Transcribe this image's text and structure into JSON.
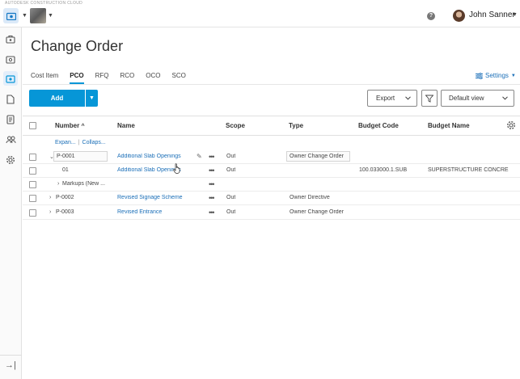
{
  "brand": "AUTODESK CONSTRUCTION CLOUD",
  "header": {
    "user_name": "John Sanner",
    "help": "?"
  },
  "page": {
    "title": "Change Order"
  },
  "tabs": [
    {
      "label": "Cost Item",
      "active": false
    },
    {
      "label": "PCO",
      "active": true
    },
    {
      "label": "RFQ",
      "active": false
    },
    {
      "label": "RCO",
      "active": false
    },
    {
      "label": "OCO",
      "active": false
    },
    {
      "label": "SCO",
      "active": false
    }
  ],
  "settings_label": "Settings",
  "toolbar": {
    "add_label": "Add",
    "export_label": "Export",
    "view_label": "Default view"
  },
  "table": {
    "columns": [
      "Number",
      "Name",
      "Scope",
      "Type",
      "Budget Code",
      "Budget Name"
    ],
    "sort_indicator": "^",
    "expand_label": "Expan...",
    "collapse_label": "Collaps...",
    "rows": [
      {
        "number": "P-0001",
        "name": "Additional Slab Openings",
        "scope": "Out",
        "type": "Owner Change Order",
        "budget_code": "",
        "budget_name": ""
      },
      {
        "number": "01",
        "name": "Additional Slab Openings",
        "scope": "Out",
        "type": "",
        "budget_code": "100.033000.1.SUB",
        "budget_name": "SUPERSTRUCTURE CONCRE"
      },
      {
        "number": "Markups (New ...",
        "name": "",
        "scope": "",
        "type": "",
        "budget_code": "",
        "budget_name": ""
      },
      {
        "number": "P-0002",
        "name": "Revised Signage Scheme",
        "scope": "Out",
        "type": "Owner Directive",
        "budget_code": "",
        "budget_name": ""
      },
      {
        "number": "P-0003",
        "name": "Revised Entrance",
        "scope": "Out",
        "type": "Owner Change Order",
        "budget_code": "",
        "budget_name": ""
      }
    ]
  },
  "colors": {
    "accent": "#0696d7",
    "link": "#1b6fb8"
  },
  "icons": {
    "rail": [
      "cost-management-icon",
      "submittals-icon",
      "change-order-icon",
      "document-icon",
      "forms-icon",
      "members-icon",
      "settings-icon"
    ],
    "collapse": "collapse-rail-icon"
  }
}
